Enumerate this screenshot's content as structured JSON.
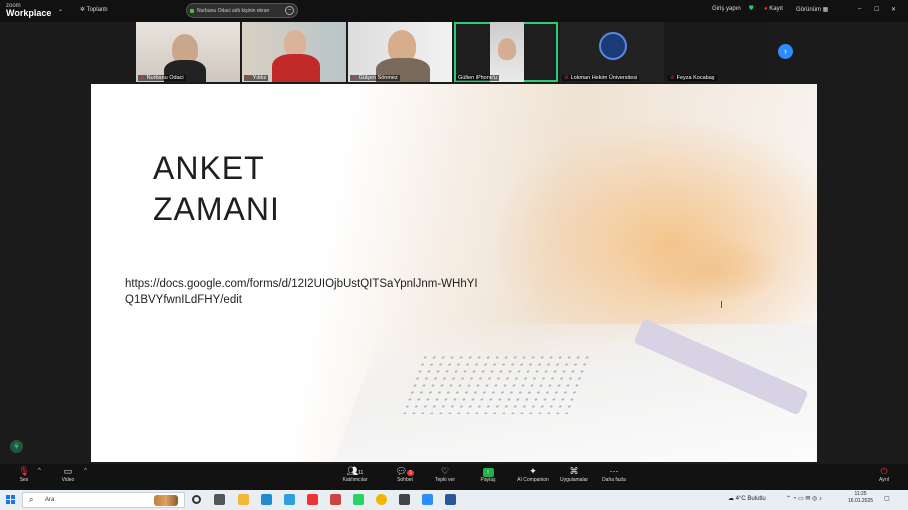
{
  "app": {
    "logo_small": "zoom",
    "logo_name": "Workplace"
  },
  "topbar": {
    "chevron": "⌄",
    "topics_label": "Toplantı",
    "share_text": "Nurbanu Odaci adlı kişinin ekran",
    "signin_label": "Giriş yapın",
    "record_label": "Kayıt",
    "view_label": "Görünüm"
  },
  "participants": [
    {
      "name": "Nurbanu Odaci"
    },
    {
      "name": "Yıldız"
    },
    {
      "name": "Gülşen Sönmez"
    },
    {
      "name": "Gülten iPhone'u"
    },
    {
      "name": "Lokman Hekim Üniversitesi"
    },
    {
      "name": "Feyza Kocabaş"
    }
  ],
  "slide": {
    "title": "ANKET\nZAMANI",
    "url": "https://docs.google.com/forms/d/12I2UIOjbUstQITSaYpnlJnm-WHhYIQ1BVYfwnILdFHY/edit"
  },
  "toolbar": {
    "left": [
      {
        "label": "Ses",
        "icon": "mic-icon"
      },
      {
        "label": "Video",
        "icon": "video-icon"
      }
    ],
    "center": [
      {
        "label": "Katılımcılar",
        "icon": "participants-icon",
        "count": "11"
      },
      {
        "label": "Sohbet",
        "icon": "chat-icon",
        "badge": "1"
      },
      {
        "label": "Tepki ver",
        "icon": "heart-icon"
      },
      {
        "label": "Paylaş",
        "icon": "share-icon"
      },
      {
        "label": "AI Companion",
        "icon": "sparkle-icon"
      },
      {
        "label": "Uygulamalar",
        "icon": "apps-icon"
      },
      {
        "label": "Daha fazla",
        "icon": "more-icon"
      }
    ],
    "right": {
      "label": "Ayrıl",
      "icon": "leave-icon"
    }
  },
  "taskbar": {
    "search_placeholder": "Ara",
    "weather": "4°C",
    "weather_text": "Bulutlu",
    "time": "11:25",
    "date": "16.01.2025"
  },
  "colors": {
    "accent": "#2d8cff",
    "active_border": "#2ecc71",
    "record": "#e33"
  }
}
